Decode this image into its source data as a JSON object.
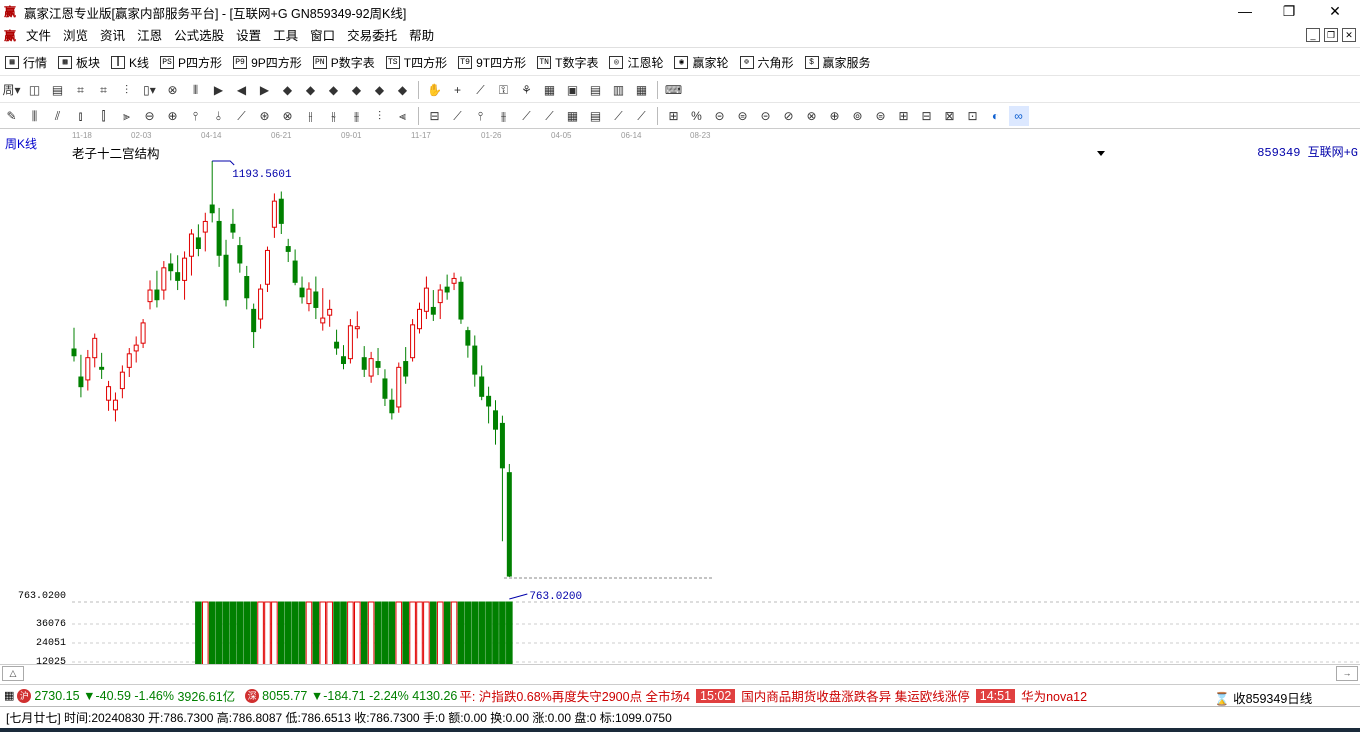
{
  "window": {
    "title": "赢家江恩专业版[赢家内部服务平台] - [互联网+G  GN859349-92周K线]",
    "app_icon_text": "赢",
    "controls": {
      "minimize": "—",
      "maximize": "❐",
      "close": "✕"
    }
  },
  "menu": {
    "items": [
      "文件",
      "浏览",
      "资讯",
      "江恩",
      "公式选股",
      "设置",
      "工具",
      "窗口",
      "交易委托",
      "帮助"
    ]
  },
  "toolbar1": {
    "items": [
      {
        "label": "行情",
        "icon": "grid-icon",
        "glyph": "▦"
      },
      {
        "label": "板块",
        "icon": "blocks-icon",
        "glyph": "▩"
      },
      {
        "label": "K线",
        "icon": "candles-icon",
        "glyph": "┃"
      },
      {
        "label": "P四方形",
        "icon": "ps-icon",
        "glyph": "PS"
      },
      {
        "label": "9P四方形",
        "icon": "p9-icon",
        "glyph": "P9"
      },
      {
        "label": "P数字表",
        "icon": "pn-icon",
        "glyph": "PN"
      },
      {
        "label": "T四方形",
        "icon": "ts-icon",
        "glyph": "TS"
      },
      {
        "label": "9T四方形",
        "icon": "t9-icon",
        "glyph": "T9"
      },
      {
        "label": "T数字表",
        "icon": "tn-icon",
        "glyph": "TN"
      },
      {
        "label": "江恩轮",
        "icon": "gann-wheel-icon",
        "glyph": "◎"
      },
      {
        "label": "赢家轮",
        "icon": "winner-wheel-icon",
        "glyph": "◉"
      },
      {
        "label": "六角形",
        "icon": "hexagon-icon",
        "glyph": "⊚"
      },
      {
        "label": "赢家服务",
        "icon": "dollar-icon",
        "glyph": "$"
      }
    ]
  },
  "chart_header": {
    "period": "周K线",
    "indicator": "老子十二宫结构",
    "code_label": "859349 互联网+G"
  },
  "date_axis": [
    "11-18",
    "02-03",
    "04-14",
    "06-21",
    "09-01",
    "11-17",
    "01-26",
    "04-05",
    "06-14",
    "08-23"
  ],
  "price_marks": {
    "high_label": "1193.5601",
    "low_label": "763.0200",
    "axis_low": "763.0200"
  },
  "volume_axis": [
    "36076",
    "24051",
    "12025"
  ],
  "chart_data": {
    "type": "candlestick",
    "ylim": [
      763.02,
      1193.5601
    ],
    "colors": {
      "up": "#e00000",
      "down": "#008000"
    },
    "candles": [
      {
        "o": 999,
        "h": 1021,
        "l": 986,
        "c": 992
      },
      {
        "o": 970,
        "h": 993,
        "l": 949,
        "c": 960
      },
      {
        "o": 967,
        "h": 998,
        "l": 956,
        "c": 990
      },
      {
        "o": 990,
        "h": 1015,
        "l": 980,
        "c": 1010
      },
      {
        "o": 980,
        "h": 995,
        "l": 968,
        "c": 978
      },
      {
        "o": 946,
        "h": 966,
        "l": 935,
        "c": 960
      },
      {
        "o": 936,
        "h": 954,
        "l": 924,
        "c": 946
      },
      {
        "o": 958,
        "h": 982,
        "l": 948,
        "c": 975
      },
      {
        "o": 980,
        "h": 1000,
        "l": 970,
        "c": 994
      },
      {
        "o": 997,
        "h": 1012,
        "l": 985,
        "c": 1003
      },
      {
        "o": 1005,
        "h": 1030,
        "l": 1000,
        "c": 1026
      },
      {
        "o": 1048,
        "h": 1070,
        "l": 1040,
        "c": 1060
      },
      {
        "o": 1060,
        "h": 1080,
        "l": 1042,
        "c": 1050
      },
      {
        "o": 1060,
        "h": 1090,
        "l": 1050,
        "c": 1083
      },
      {
        "o": 1087,
        "h": 1098,
        "l": 1070,
        "c": 1080
      },
      {
        "o": 1078,
        "h": 1096,
        "l": 1060,
        "c": 1070
      },
      {
        "o": 1070,
        "h": 1100,
        "l": 1050,
        "c": 1093
      },
      {
        "o": 1095,
        "h": 1123,
        "l": 1075,
        "c": 1118
      },
      {
        "o": 1114,
        "h": 1128,
        "l": 1095,
        "c": 1103
      },
      {
        "o": 1120,
        "h": 1140,
        "l": 1100,
        "c": 1131
      },
      {
        "o": 1148,
        "h": 1193.56,
        "l": 1130,
        "c": 1140
      },
      {
        "o": 1131,
        "h": 1145,
        "l": 1084,
        "c": 1096
      },
      {
        "o": 1096,
        "h": 1112,
        "l": 1043,
        "c": 1050
      },
      {
        "o": 1128,
        "h": 1144,
        "l": 1113,
        "c": 1120
      },
      {
        "o": 1106,
        "h": 1115,
        "l": 1078,
        "c": 1088
      },
      {
        "o": 1074,
        "h": 1085,
        "l": 1040,
        "c": 1052
      },
      {
        "o": 1040,
        "h": 1046,
        "l": 1000,
        "c": 1017
      },
      {
        "o": 1030,
        "h": 1066,
        "l": 1020,
        "c": 1061
      },
      {
        "o": 1066,
        "h": 1105,
        "l": 1058,
        "c": 1101
      },
      {
        "o": 1125,
        "h": 1160,
        "l": 1114,
        "c": 1152
      },
      {
        "o": 1154,
        "h": 1162,
        "l": 1118,
        "c": 1129
      },
      {
        "o": 1105,
        "h": 1113,
        "l": 1089,
        "c": 1100
      },
      {
        "o": 1090,
        "h": 1102,
        "l": 1065,
        "c": 1068
      },
      {
        "o": 1062,
        "h": 1074,
        "l": 1046,
        "c": 1053
      },
      {
        "o": 1046,
        "h": 1068,
        "l": 1038,
        "c": 1061
      },
      {
        "o": 1058,
        "h": 1074,
        "l": 1030,
        "c": 1042
      },
      {
        "o": 1026,
        "h": 1062,
        "l": 1018,
        "c": 1031
      },
      {
        "o": 1034,
        "h": 1050,
        "l": 1022,
        "c": 1040
      },
      {
        "o": 1006,
        "h": 1019,
        "l": 993,
        "c": 1000
      },
      {
        "o": 991,
        "h": 1003,
        "l": 978,
        "c": 984
      },
      {
        "o": 989,
        "h": 1030,
        "l": 984,
        "c": 1023
      },
      {
        "o": 1020,
        "h": 1038,
        "l": 1010,
        "c": 1022
      },
      {
        "o": 990,
        "h": 1002,
        "l": 970,
        "c": 978
      },
      {
        "o": 971,
        "h": 996,
        "l": 964,
        "c": 989
      },
      {
        "o": 986,
        "h": 1000,
        "l": 972,
        "c": 980
      },
      {
        "o": 968,
        "h": 978,
        "l": 940,
        "c": 948
      },
      {
        "o": 946,
        "h": 958,
        "l": 926,
        "c": 933
      },
      {
        "o": 939,
        "h": 985,
        "l": 933,
        "c": 980
      },
      {
        "o": 986,
        "h": 1001,
        "l": 963,
        "c": 971
      },
      {
        "o": 990,
        "h": 1030,
        "l": 986,
        "c": 1024
      },
      {
        "o": 1020,
        "h": 1047,
        "l": 1015,
        "c": 1040
      },
      {
        "o": 1038,
        "h": 1074,
        "l": 1030,
        "c": 1062
      },
      {
        "o": 1042,
        "h": 1060,
        "l": 1028,
        "c": 1035
      },
      {
        "o": 1047,
        "h": 1066,
        "l": 1030,
        "c": 1060
      },
      {
        "o": 1063,
        "h": 1076,
        "l": 1050,
        "c": 1058
      },
      {
        "o": 1067,
        "h": 1078,
        "l": 1060,
        "c": 1072
      },
      {
        "o": 1068,
        "h": 1074,
        "l": 1025,
        "c": 1030
      },
      {
        "o": 1018,
        "h": 1022,
        "l": 990,
        "c": 1003
      },
      {
        "o": 1002,
        "h": 1013,
        "l": 960,
        "c": 973
      },
      {
        "o": 970,
        "h": 982,
        "l": 946,
        "c": 950
      },
      {
        "o": 950,
        "h": 960,
        "l": 922,
        "c": 940
      },
      {
        "o": 935,
        "h": 946,
        "l": 900,
        "c": 916
      },
      {
        "o": 922,
        "h": 930,
        "l": 800,
        "c": 876
      },
      {
        "o": 871,
        "h": 880,
        "l": 763.02,
        "c": 764
      }
    ],
    "volume_bars": 47
  },
  "statusbar": {
    "sh_badge": "沪",
    "sh_index": "2730.15",
    "sh_change": "▼-40.59",
    "sh_pct": "-1.46%",
    "sh_amount": "3926.61亿",
    "sz_badge": "深",
    "sz_index": "8055.77",
    "sz_change": "▼-184.71",
    "sz_pct": "-2.24%",
    "sz_amount": "4130.26",
    "news1": "平: 沪指跌0.68%再度失守2900点 全市场4",
    "time2": "15:02",
    "news2": "国内商品期货收盘涨跌各异 集运欧线涨停",
    "time3": "14:51",
    "news3": "华为nova12",
    "right_text": "收859349日线"
  },
  "infobar": {
    "text": "[七月廿七] 时间:20240830 开:786.7300 高:786.8087 低:786.6513 收:786.7300 手:0 额:0.00 换:0.00 涨:0.00 盘:0 标:1099.0750"
  },
  "scroll": {
    "left": "△",
    "right": "→"
  }
}
